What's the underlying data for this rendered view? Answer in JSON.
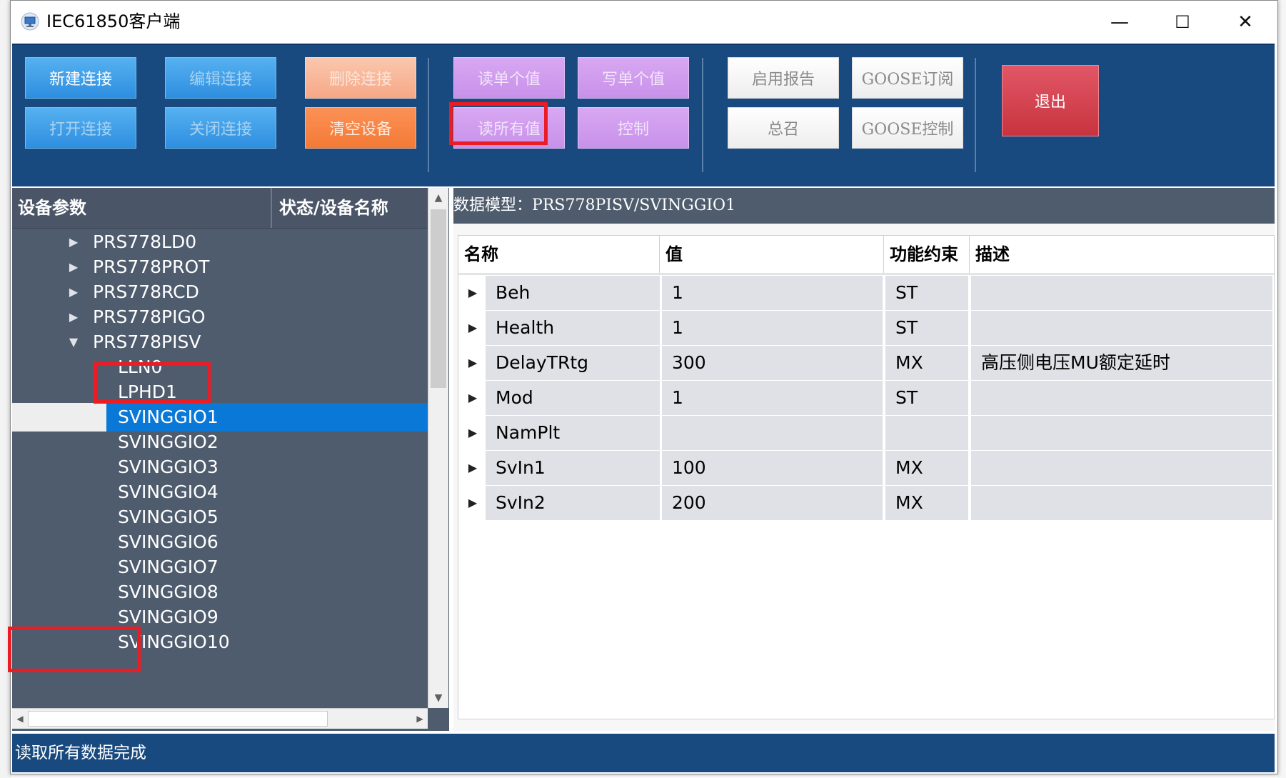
{
  "window": {
    "title": "IEC61850客户端",
    "minimize": "—",
    "maximize": "☐",
    "close": "✕"
  },
  "toolbar": {
    "new_connection": "新建连接",
    "edit_connection": "编辑连接",
    "delete_connection": "删除连接",
    "open_connection": "打开连接",
    "close_connection": "关闭连接",
    "clear_devices": "清空设备",
    "read_single": "读单个值",
    "write_single": "写单个值",
    "read_all": "读所有值",
    "control": "控制",
    "enable_report": "启用报告",
    "goose_subscribe": "GOOSE订阅",
    "general_call": "总召",
    "goose_control": "GOOSE控制",
    "exit": "退出"
  },
  "tree": {
    "header_param": "设备参数",
    "header_status": "状态/设备名称",
    "items": [
      {
        "label": "PRS778LD0",
        "expander": "▶"
      },
      {
        "label": "PRS778PROT",
        "expander": "▶"
      },
      {
        "label": "PRS778RCD",
        "expander": "▶"
      },
      {
        "label": "PRS778PIGO",
        "expander": "▶"
      },
      {
        "label": "PRS778PISV",
        "expander": "▼"
      },
      {
        "label": "LLN0"
      },
      {
        "label": "LPHD1"
      },
      {
        "label": "SVINGGIO1"
      },
      {
        "label": "SVINGGIO2"
      },
      {
        "label": "SVINGGIO3"
      },
      {
        "label": "SVINGGIO4"
      },
      {
        "label": "SVINGGIO5"
      },
      {
        "label": "SVINGGIO6"
      },
      {
        "label": "SVINGGIO7"
      },
      {
        "label": "SVINGGIO8"
      },
      {
        "label": "SVINGGIO9"
      },
      {
        "label": "SVINGGIO10"
      }
    ],
    "selected": "SVINGGIO1"
  },
  "datamodel": {
    "title_prefix": "数据模型：",
    "title_path": "PRS778PISV/SVINGGIO1",
    "columns": [
      "名称",
      "值",
      "功能约束",
      "描述"
    ],
    "rows": [
      {
        "name": "Beh",
        "value": "1",
        "fc": "ST",
        "desc": ""
      },
      {
        "name": "Health",
        "value": "1",
        "fc": "ST",
        "desc": ""
      },
      {
        "name": "DelayTRtg",
        "value": "300",
        "fc": "MX",
        "desc": "高压侧电压MU额定延时"
      },
      {
        "name": "Mod",
        "value": "1",
        "fc": "ST",
        "desc": ""
      },
      {
        "name": "NamPlt",
        "value": "",
        "fc": "",
        "desc": ""
      },
      {
        "name": "SvIn1",
        "value": "100",
        "fc": "MX",
        "desc": ""
      },
      {
        "name": "SvIn2",
        "value": "200",
        "fc": "MX",
        "desc": ""
      }
    ]
  },
  "status": {
    "message": "读取所有数据完成"
  },
  "colors": {
    "toolbar_bg": "#184a7f",
    "panel_bg": "#4f5c6e",
    "selection": "#0a78d7",
    "highlight": "#ec1c24"
  }
}
